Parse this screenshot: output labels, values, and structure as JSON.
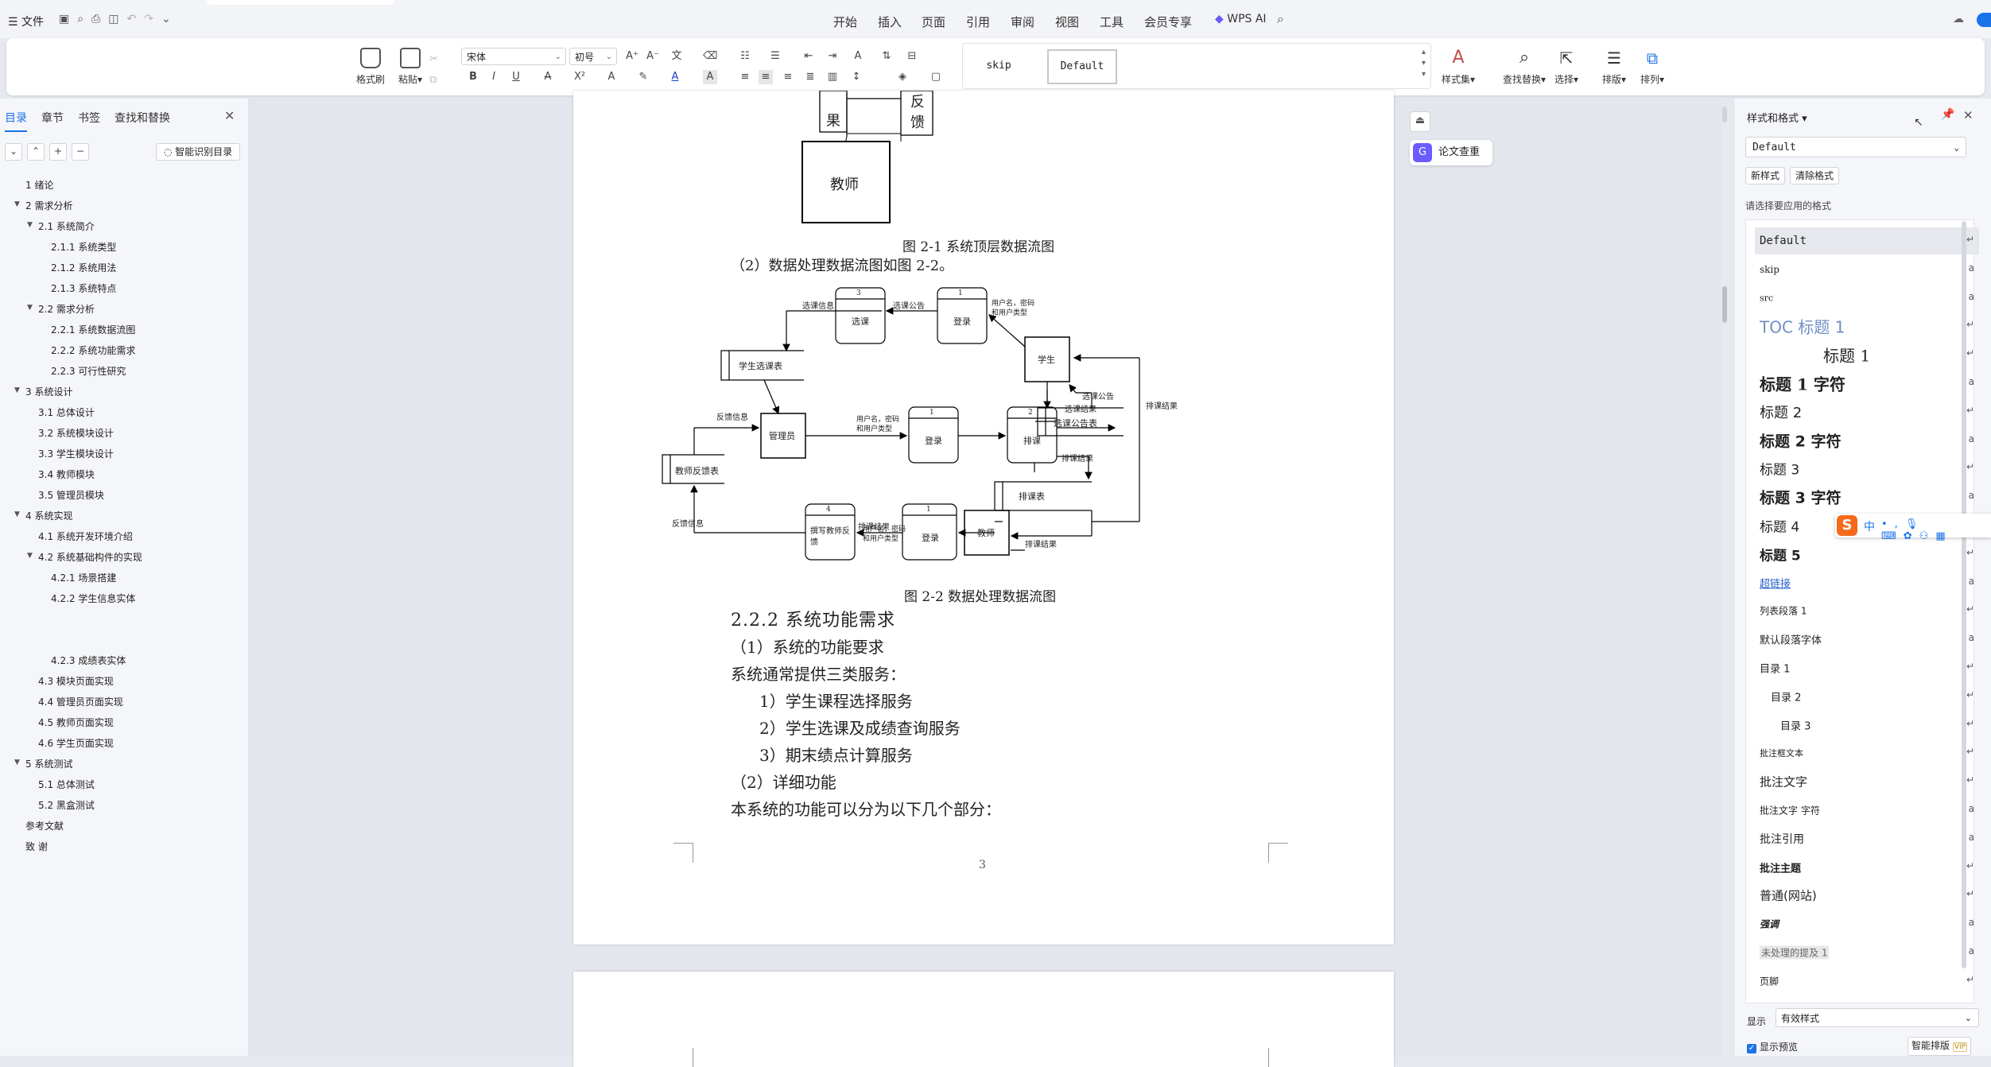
{
  "menubar": {
    "file": "文件",
    "tabs": [
      "开始",
      "插入",
      "页面",
      "引用",
      "审阅",
      "视图",
      "工具",
      "会员专享"
    ],
    "active_tab": "开始",
    "wps_ai": "WPS AI"
  },
  "ribbon": {
    "format_painter": "格式刷",
    "paste": "粘贴",
    "font": "宋体",
    "font_size": "初号",
    "styles": [
      "skip",
      "Default"
    ],
    "style_set": "样式集",
    "find_replace": "查找替换",
    "select": "选择",
    "layout": "排版",
    "arrange": "排列"
  },
  "nav": {
    "tabs": [
      "目录",
      "章节",
      "书签",
      "查找和替换"
    ],
    "active_tab": "目录",
    "smart_toc": "智能识别目录",
    "items": [
      {
        "label": "1  绪论",
        "level": 1,
        "caret": false
      },
      {
        "label": "2  需求分析",
        "level": 1,
        "caret": true
      },
      {
        "label": "2.1  系统简介",
        "level": 2,
        "caret": true
      },
      {
        "label": "2.1.1  系统类型",
        "level": 3,
        "caret": false
      },
      {
        "label": "2.1.2  系统用法",
        "level": 3,
        "caret": false
      },
      {
        "label": "2.1.3 系统特点",
        "level": 3,
        "caret": false
      },
      {
        "label": "2.2  需求分析",
        "level": 2,
        "caret": true
      },
      {
        "label": "2.2.1  系统数据流图",
        "level": 3,
        "caret": false
      },
      {
        "label": "2.2.2  系统功能需求",
        "level": 3,
        "caret": false
      },
      {
        "label": "2.2.3  可行性研究",
        "level": 3,
        "caret": false
      },
      {
        "label": "3  系统设计",
        "level": 1,
        "caret": true
      },
      {
        "label": "3.1  总体设计",
        "level": 2,
        "caret": false
      },
      {
        "label": "3.2  系统模块设计",
        "level": 2,
        "caret": false
      },
      {
        "label": "3.3  学生模块设计",
        "level": 2,
        "caret": false
      },
      {
        "label": "3.4  教师模块",
        "level": 2,
        "caret": false
      },
      {
        "label": "3.5  管理员模块",
        "level": 2,
        "caret": false
      },
      {
        "label": "4  系统实现",
        "level": 1,
        "caret": true
      },
      {
        "label": "4.1  系统开发环境介绍",
        "level": 2,
        "caret": false
      },
      {
        "label": "4.2  系统基础构件的实现",
        "level": 2,
        "caret": true
      },
      {
        "label": "4.2.1  场景搭建",
        "level": 3,
        "caret": false
      },
      {
        "label": "4.2.2  学生信息实体",
        "level": 3,
        "caret": false
      },
      {
        "label": "4.2.3  成绩表实体",
        "level": 3,
        "caret": false,
        "gap": true
      },
      {
        "label": "4.3  模块页面实现",
        "level": 2,
        "caret": false
      },
      {
        "label": "4.4  管理员页面实现",
        "level": 2,
        "caret": false
      },
      {
        "label": "4.5  教师页面实现",
        "level": 2,
        "caret": false
      },
      {
        "label": "4.6  学生页面实现",
        "level": 2,
        "caret": false
      },
      {
        "label": "5  系统测试",
        "level": 1,
        "caret": true
      },
      {
        "label": "5.1  总体测试",
        "level": 2,
        "caret": false
      },
      {
        "label": "5.2  黑盒测试",
        "level": 2,
        "caret": false
      },
      {
        "label": "参考文献",
        "level": 1,
        "caret": false
      },
      {
        "label": "致   谢",
        "level": 1,
        "caret": false
      }
    ]
  },
  "float_tools": {
    "paper_check": "论文查重"
  },
  "doc": {
    "fig_top": {
      "box_guo": "果",
      "box_fankui": "反\n馈",
      "teacher": "教师"
    },
    "caption1": "图 2-1  系统顶层数据流图",
    "para_intro": "（2）数据处理数据流图如图 2-2。",
    "dfd": {
      "p3_num": "3",
      "p3_label": "选课",
      "p1a_num": "1",
      "p1a_label": "登录",
      "p1b_num": "1",
      "p1b_label": "登录",
      "p2_num": "2",
      "p2_label": "排课",
      "p4_num": "4",
      "p4_label": "撰写教师反\n馈",
      "p1c_num": "1",
      "p1c_label": "登录",
      "student": "学生",
      "admin": "管理员",
      "teacher": "教师",
      "ds_xkb": "学生选课表",
      "ds_gg": "选课公告表",
      "ds_pkb": "排课表",
      "ds_fk": "教师反馈表",
      "f_xkxx": "选课信息",
      "f_xkgg": "选课公告",
      "f_user1": "用户名，密码\n和用户类型",
      "f_user2": "用户名，密码\n和用户类型",
      "f_user3": "用户名，密码\n和用户类型",
      "f_fkxx1": "反馈信息",
      "f_fkxx2": "反馈信息",
      "f_xkjg": "选课结果",
      "f_xkgg2": "选课公告",
      "f_pkjg1": "排课结果",
      "f_pkjg2": "排课结果",
      "f_pkjg3": "排课结果",
      "f_pkjg4": "排课结果"
    },
    "caption2": "图 2-2 数据处理数据流图",
    "heading": "2.2.2  系统功能需求",
    "lines": [
      "（1）系统的功能要求",
      "系统通常提供三类服务：",
      "1）学生课程选择服务",
      "2）学生选课及成绩查询服务",
      "3）期末绩点计算服务",
      "（2）详细功能",
      "本系统的功能可以分为以下几个部分："
    ],
    "page_number": "3"
  },
  "styles_pane": {
    "title": "样式和格式",
    "current": "Default",
    "new_style": "新样式",
    "clear_format": "清除格式",
    "prompt": "请选择要应用的格式",
    "items": [
      {
        "label": "Default",
        "mark": "↵"
      },
      {
        "label": "skip",
        "mark": "a"
      },
      {
        "label": "src",
        "mark": "a"
      },
      {
        "label": "TOC 标题 1",
        "mark": "↵"
      },
      {
        "label": "标题 1",
        "mark": "↵"
      },
      {
        "label": "标题 1 字符",
        "mark": "a"
      },
      {
        "label": "标题 2",
        "mark": "↵"
      },
      {
        "label": "标题 2 字符",
        "mark": "a"
      },
      {
        "label": "标题 3",
        "mark": "↵"
      },
      {
        "label": "标题 3 字符",
        "mark": "a"
      },
      {
        "label": "标题 4",
        "mark": "↵"
      },
      {
        "label": "标题 5",
        "mark": "↵"
      },
      {
        "label": "超链接",
        "mark": "a"
      },
      {
        "label": "列表段落 1",
        "mark": "↵"
      },
      {
        "label": "默认段落字体",
        "mark": "a"
      },
      {
        "label": "目录 1",
        "mark": "↵"
      },
      {
        "label": "目录 2",
        "mark": "↵"
      },
      {
        "label": "目录 3",
        "mark": "↵"
      },
      {
        "label": "批注框文本",
        "mark": "↵"
      },
      {
        "label": "批注文字",
        "mark": "↵"
      },
      {
        "label": "批注文字 字符",
        "mark": "a"
      },
      {
        "label": "批注引用",
        "mark": "a"
      },
      {
        "label": "批注主题",
        "mark": "↵"
      },
      {
        "label": "普通(网站)",
        "mark": "↵"
      },
      {
        "label": "强调",
        "mark": "a"
      },
      {
        "label": "未处理的提及 1",
        "mark": "a"
      },
      {
        "label": "页脚",
        "mark": "↵"
      }
    ],
    "show_label": "显示",
    "show_value": "有效样式",
    "show_preview": "显示预览",
    "smart_layout": "智能排版",
    "vip": "VIP"
  },
  "ime": {
    "mode": "中"
  },
  "colors": {
    "accent": "#1a73e8",
    "ime_orange": "#f46a1b",
    "hyperlink": "#2b62c9",
    "toc_heading": "#6f8fc4"
  }
}
